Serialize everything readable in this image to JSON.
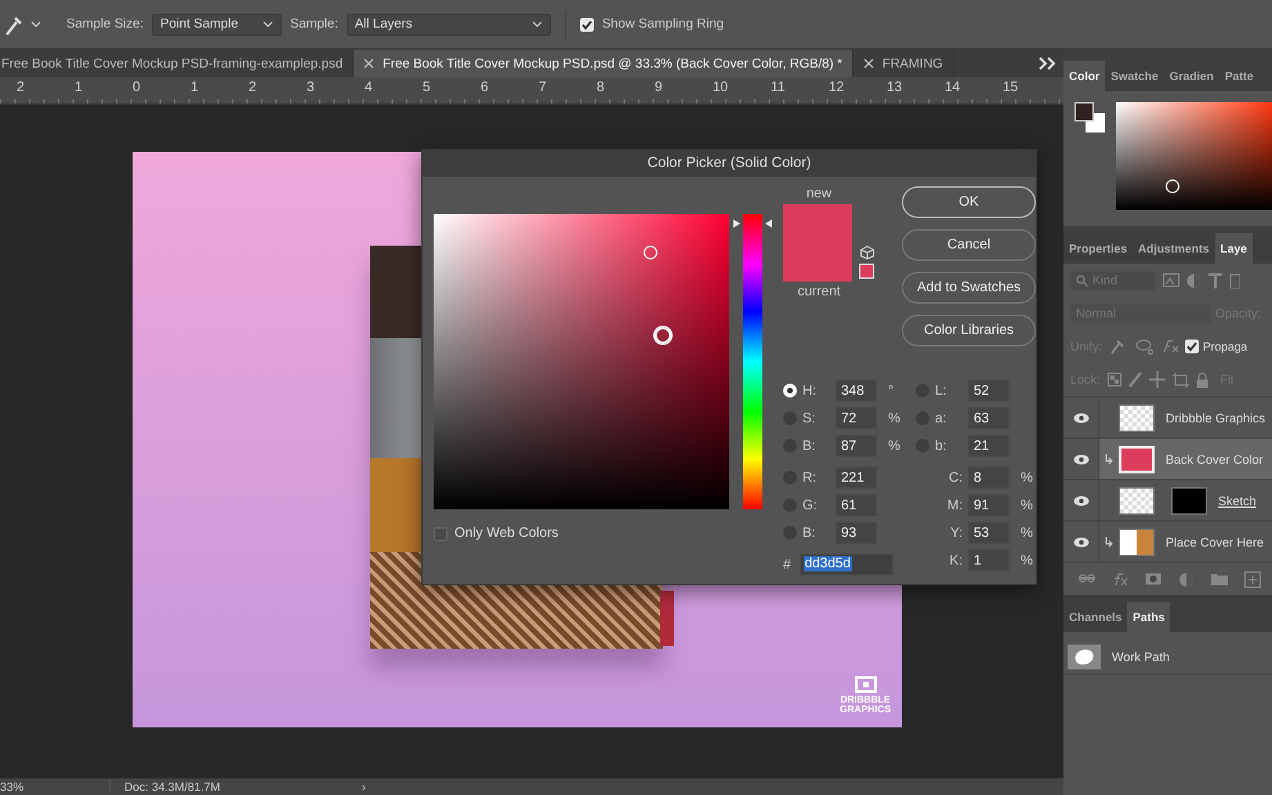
{
  "options_bar": {
    "sample_size_label": "Sample Size:",
    "sample_size_value": "Point Sample",
    "sample_label": "Sample:",
    "sample_value": "All Layers",
    "sampling_ring": {
      "label": "Show Sampling Ring",
      "checked": true
    }
  },
  "document_tabs": [
    {
      "title": "Free Book Title Cover Mockup PSD-framing-examplep.psd",
      "selected": false,
      "close_shown": false
    },
    {
      "title": "Free Book Title Cover Mockup PSD.psd @ 33.3% (Back Cover Color, RGB/8) *",
      "selected": true,
      "close_shown": true
    },
    {
      "title": "FRAMING",
      "selected": false,
      "close_shown": true
    }
  ],
  "ruler": {
    "labels": [
      "2",
      "1",
      "0",
      "1",
      "2",
      "3",
      "4",
      "5",
      "6",
      "7",
      "8",
      "9",
      "10",
      "11",
      "12",
      "13",
      "14",
      "15"
    ]
  },
  "canvas": {
    "logo_lines": [
      "DRIBBBLE",
      "GRAPHICS"
    ]
  },
  "color_picker": {
    "title": "Color Picker (Solid Color)",
    "new_label": "new",
    "current_label": "current",
    "hue_slider": {
      "level": 0.967
    },
    "buttons": [
      {
        "label": "OK",
        "kind": "default"
      },
      {
        "label": "Cancel",
        "kind": "normal"
      },
      {
        "label": "Add to Swatches",
        "kind": "normal"
      },
      {
        "label": "Color Libraries",
        "kind": "normal"
      }
    ],
    "left_fields": [
      {
        "label": "H:",
        "value": "348",
        "unit": "°",
        "selected": true,
        "kind": "radio"
      },
      {
        "label": "S:",
        "value": "72",
        "unit": "%",
        "selected": false,
        "kind": "radio"
      },
      {
        "label": "B:",
        "value": "87",
        "unit": "%",
        "selected": false,
        "kind": "radio"
      },
      {
        "label": "R:",
        "value": "221",
        "selected": false,
        "kind": "radio"
      },
      {
        "label": "G:",
        "value": "61",
        "selected": false,
        "kind": "radio"
      },
      {
        "label": "B:",
        "value": "93",
        "selected": false,
        "kind": "radio"
      }
    ],
    "right_fields": [
      {
        "label": "L:",
        "value": "52",
        "selected": false,
        "kind": "radio"
      },
      {
        "label": "a:",
        "value": "63",
        "selected": false,
        "kind": "radio"
      },
      {
        "label": "b:",
        "value": "21",
        "selected": false,
        "kind": "radio"
      },
      {
        "label": "C:",
        "value": "8",
        "unit": "%",
        "kind": "plain"
      },
      {
        "label": "M:",
        "value": "91",
        "unit": "%",
        "kind": "plain"
      },
      {
        "label": "Y:",
        "value": "53",
        "unit": "%",
        "kind": "plain"
      },
      {
        "label": "K:",
        "value": "1",
        "unit": "%",
        "kind": "plain"
      }
    ],
    "hex_label": "#",
    "hex_value": "dd3d5d",
    "only_web_colors": {
      "label": "Only Web Colors",
      "checked": false
    }
  },
  "color_panel": {
    "tabs": [
      {
        "label": "Color",
        "selected": true
      },
      {
        "label": "Swatche",
        "selected": false
      },
      {
        "label": "Gradien",
        "selected": false
      },
      {
        "label": "Patte",
        "selected": false
      }
    ]
  },
  "layers_panel": {
    "tabs": [
      {
        "label": "Properties",
        "selected": false
      },
      {
        "label": "Adjustments",
        "selected": false
      },
      {
        "label": "Laye",
        "selected": true
      }
    ],
    "filter_placeholder": "Kind",
    "blend_mode": "Normal",
    "opacity_label": "Opacity:",
    "unify_label": "Unify:",
    "propagate": {
      "label": "Propaga",
      "checked": true
    },
    "lock_label": "Lock:",
    "fill_label": "Fil",
    "layers": [
      {
        "name": "Dribbble Graphics",
        "visible": true,
        "selected": false,
        "kind": "pixel",
        "clipped": false
      },
      {
        "name": "Back Cover Color",
        "visible": true,
        "selected": true,
        "kind": "fill",
        "clipped": true
      },
      {
        "name": "Sketch",
        "visible": true,
        "selected": false,
        "kind": "masked",
        "clipped": false
      },
      {
        "name": "Place Cover Here",
        "visible": true,
        "selected": false,
        "kind": "smart",
        "clipped": true
      }
    ]
  },
  "paths_panel": {
    "tabs": [
      {
        "label": "Channels",
        "selected": false
      },
      {
        "label": "Paths",
        "selected": true
      }
    ],
    "paths": [
      {
        "name": "Work Path"
      }
    ]
  },
  "status_bar": {
    "zoom": "33%",
    "doc_size": "Doc: 34.3M/81.7M",
    "arrow": "›"
  }
}
